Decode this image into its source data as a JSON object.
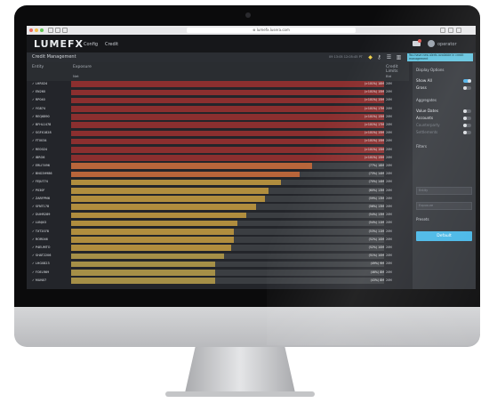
{
  "browser": {
    "url": "⊕ lumefx.lusera.com"
  },
  "app": {
    "logo": "LUMEFX",
    "nav": [
      "Config",
      "Credit"
    ],
    "user": "operator"
  },
  "subheader": {
    "title": "Credit Management",
    "clock": "09 13:05 12:05:45 PT",
    "banner": "You have new alerts available in credit management"
  },
  "table": {
    "col_entity": "Entity",
    "col_exposure": "Exposure",
    "col_sub": "Net",
    "col_limits": "Credit Limits",
    "col_limits_sub": "Bid"
  },
  "chart_data": {
    "type": "bar",
    "categories": [
      "LHR024",
      "EN260",
      "RP040",
      "YG874",
      "REQ6890",
      "BFHL1478",
      "SGFX1828",
      "FT0034",
      "RE0024",
      "IBRO6",
      "ERLI7496",
      "BNG3H986",
      "FEJU774",
      "P030F",
      "ZARFPM6",
      "SFNT178",
      "DUHR289",
      "LUNJ43",
      "TXT2078",
      "ROR046",
      "P4EUMTO",
      "SHAT2206",
      "LHG0823",
      "FOELR69",
      "MUN07"
    ],
    "values": [
      101,
      101,
      101,
      101,
      101,
      101,
      101,
      101,
      101,
      101,
      77,
      73,
      67,
      63,
      62,
      59,
      56,
      53,
      52,
      52,
      51,
      49,
      46,
      46,
      46
    ],
    "labels": [
      "(>101%) 18M",
      "(>101%) 15M",
      "(>101%) 15M",
      "(>101%) 17M",
      "(>101%) 15M",
      "(>101%) 17M",
      "(>101%) 15M",
      "(>101%) 15M",
      "(>101%) 15M",
      "(>101%) 15M",
      "(77%) 18M",
      "(73%) 14M",
      "(70%) 14M",
      "(60%) 13M",
      "(59%) 13M",
      "(56%) 13M",
      "(54%) 13M",
      "(54%) 11M",
      "(53%) 11M",
      "(52%) 10M",
      "(52%) 10M",
      "(51%) 10M",
      "(49%) 9M",
      "(46%) 8M",
      "(43%) 8M"
    ],
    "limits": [
      "20M",
      "20M",
      "20M",
      "20M",
      "20M",
      "20M",
      "20M",
      "20M",
      "20M",
      "20M",
      "20M",
      "20M",
      "20M",
      "20M",
      "20M",
      "20M",
      "20M",
      "20M",
      "20M",
      "20M",
      "20M",
      "20M",
      "20M",
      "20M",
      "20M"
    ],
    "xlim": [
      0,
      100
    ]
  },
  "side": {
    "display_options": "Display Options",
    "show_all": "Show All",
    "gross": "Gross",
    "aggregates": "Aggregates",
    "value_dates": "Value Dates",
    "accounts": "Accounts",
    "counterparty": "Counterparty",
    "settlements": "Settlements",
    "filters": "Filters",
    "filter_placeholder_1": "Entity",
    "filter_placeholder_2": "Exposure",
    "presets": "Presets",
    "default_button": "Default"
  },
  "colors": {
    "red": "#8b2f2f",
    "orange": "#b8653a",
    "gold": "#b08d3e",
    "khaki": "#a58f47"
  }
}
